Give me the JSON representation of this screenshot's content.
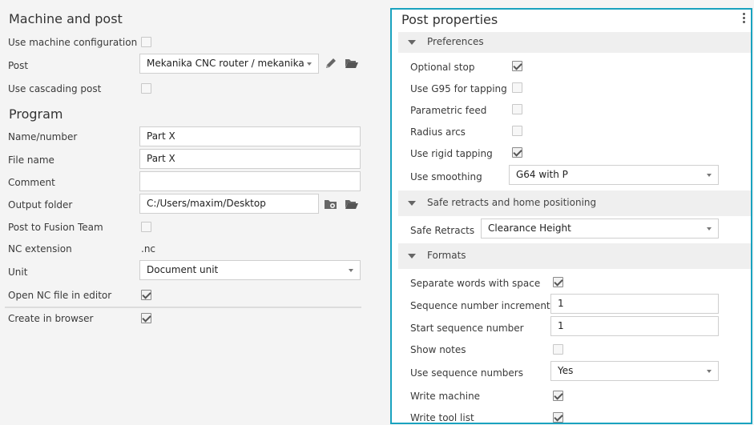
{
  "machine": {
    "title": "Machine and post",
    "use_machine_config": "Use machine configuration",
    "post_label": "Post",
    "post_value": "Mekanika CNC router / mekanika",
    "use_cascading": "Use cascading post"
  },
  "program": {
    "title": "Program",
    "name_label": "Name/number",
    "name_value": "Part X",
    "file_label": "File name",
    "file_value": "Part X",
    "comment_label": "Comment",
    "comment_value": "",
    "output_label": "Output folder",
    "output_value": "C:/Users/maxim/Desktop",
    "fusion_label": "Post to Fusion Team",
    "ext_label": "NC extension",
    "ext_value": ".nc",
    "unit_label": "Unit",
    "unit_value": "Document unit",
    "open_nc_label": "Open NC file in editor",
    "create_browser_label": "Create in browser"
  },
  "post_props": {
    "title": "Post properties",
    "preferences": {
      "title": "Preferences",
      "optional_stop": "Optional stop",
      "g95": "Use G95 for tapping",
      "parametric_feed": "Parametric feed",
      "radius_arcs": "Radius arcs",
      "rigid_tapping": "Use rigid tapping",
      "smoothing_label": "Use smoothing",
      "smoothing_value": "G64 with P"
    },
    "safe": {
      "title": "Safe retracts and home positioning",
      "retracts_label": "Safe Retracts",
      "retracts_value": "Clearance Height"
    },
    "formats": {
      "title": "Formats",
      "separate_words": "Separate words with space",
      "seq_increment_label": "Sequence number increment",
      "seq_increment_value": "1",
      "start_seq_label": "Start sequence number",
      "start_seq_value": "1",
      "show_notes": "Show notes",
      "use_seq_label": "Use sequence numbers",
      "use_seq_value": "Yes",
      "write_machine": "Write machine",
      "write_tool_list": "Write tool list"
    }
  },
  "colors": {
    "accent": "#19a2bf"
  },
  "icons": [
    "pencil-icon",
    "folder-open-icon",
    "folder-view-icon",
    "kebab-menu-icon"
  ]
}
